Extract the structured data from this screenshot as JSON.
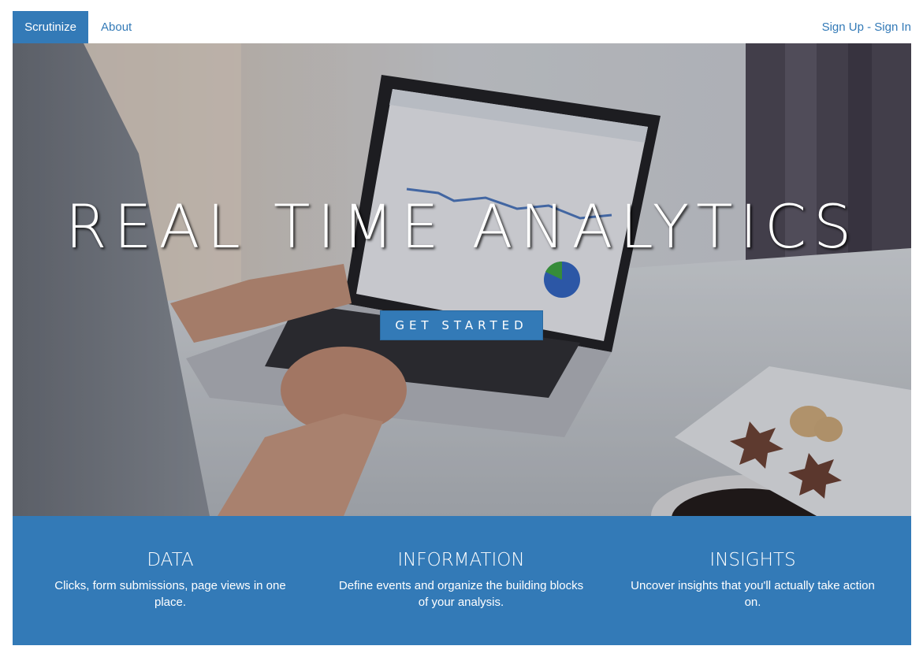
{
  "nav": {
    "brand": "Scrutinize",
    "about": "About",
    "sign_up": "Sign Up",
    "separator": " - ",
    "sign_in": "Sign In"
  },
  "hero": {
    "title": "REAL TIME ANALYTICS",
    "cta": "GET STARTED"
  },
  "features": [
    {
      "title": "DATA",
      "text": "Clicks, form submissions, page views in one place."
    },
    {
      "title": "INFORMATION",
      "text": "Define events and organize the building blocks of your analysis."
    },
    {
      "title": "INSIGHTS",
      "text": "Uncover insights that you'll actually take action on."
    }
  ],
  "colors": {
    "primary": "#337ab7",
    "white": "#ffffff"
  }
}
